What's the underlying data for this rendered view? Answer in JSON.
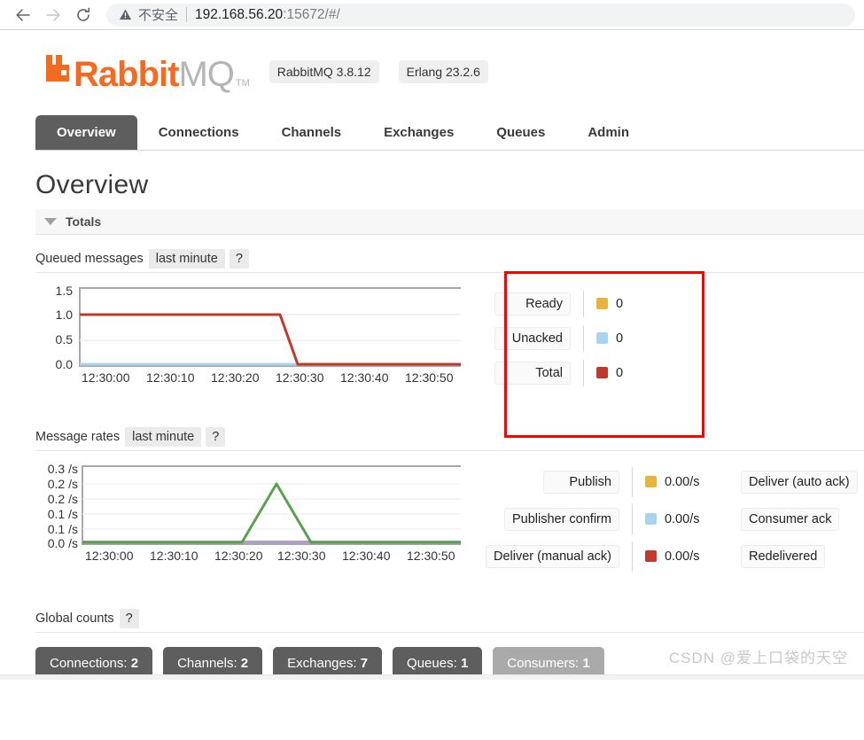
{
  "browser": {
    "back_icon": "arrow-left-icon",
    "forward_icon": "arrow-right-icon",
    "reload_icon": "reload-icon",
    "security_icon": "warning-triangle-icon",
    "security_label": "不安全",
    "url_host": "192.168.56.20",
    "url_rest": ":15672/#/"
  },
  "brand": {
    "logo_rabbit": "Rabbit",
    "logo_mq": "MQ",
    "trademark": "TM",
    "version_badge": "RabbitMQ 3.8.12",
    "erlang_badge": "Erlang 23.2.6"
  },
  "nav": {
    "tabs": [
      {
        "label": "Overview",
        "active": true
      },
      {
        "label": "Connections",
        "active": false
      },
      {
        "label": "Channels",
        "active": false
      },
      {
        "label": "Exchanges",
        "active": false
      },
      {
        "label": "Queues",
        "active": false
      },
      {
        "label": "Admin",
        "active": false
      }
    ]
  },
  "page": {
    "title": "Overview",
    "totals_label": "Totals"
  },
  "queued": {
    "title": "Queued messages",
    "period": "last minute",
    "help": "?",
    "legend": [
      {
        "label": "Ready",
        "color": "#e8b33a",
        "value": "0"
      },
      {
        "label": "Unacked",
        "color": "#a8d4f0",
        "value": "0"
      },
      {
        "label": "Total",
        "color": "#c0392b",
        "value": "0"
      }
    ]
  },
  "rates": {
    "title": "Message rates",
    "period": "last minute",
    "help": "?",
    "legend_left": [
      {
        "label": "Publish",
        "color": "#e8b33a",
        "value": "0.00/s"
      },
      {
        "label": "Publisher confirm",
        "color": "#a8d4f0",
        "value": "0.00/s"
      },
      {
        "label": "Deliver (manual ack)",
        "color": "#c0392b",
        "value": "0.00/s"
      }
    ],
    "legend_right": [
      {
        "label": "Deliver (auto ack)"
      },
      {
        "label": "Consumer ack"
      },
      {
        "label": "Redelivered"
      }
    ]
  },
  "global_counts": {
    "title": "Global counts",
    "help": "?",
    "items": [
      {
        "label": "Connections:",
        "value": "2",
        "muted": false
      },
      {
        "label": "Channels:",
        "value": "2",
        "muted": false
      },
      {
        "label": "Exchanges:",
        "value": "7",
        "muted": false
      },
      {
        "label": "Queues:",
        "value": "1",
        "muted": false
      },
      {
        "label": "Consumers:",
        "value": "1",
        "muted": true
      }
    ]
  },
  "watermark": "CSDN @爱上口袋的天空",
  "chart_data": [
    {
      "type": "line",
      "title": "Queued messages",
      "xlabel": "",
      "ylabel": "",
      "ylim": [
        0,
        1.5
      ],
      "yticks": [
        "0.0",
        "0.5",
        "1.0",
        "1.5"
      ],
      "xticks": [
        "12:30:00",
        "12:30:10",
        "12:30:20",
        "12:30:30",
        "12:30:40",
        "12:30:50"
      ],
      "grid": true,
      "legend_position": "right",
      "series": [
        {
          "name": "Total",
          "color": "#c0392b",
          "x": [
            "12:30:00",
            "12:30:10",
            "12:30:20",
            "12:30:30",
            "12:30:33",
            "12:30:40",
            "12:30:50",
            "12:30:59"
          ],
          "values": [
            1,
            1,
            1,
            1,
            0,
            0,
            0,
            0
          ]
        },
        {
          "name": "Unacked",
          "color": "#a8d4f0",
          "x": [
            "12:30:00",
            "12:30:10",
            "12:30:20",
            "12:30:30",
            "12:30:40",
            "12:30:50",
            "12:30:59"
          ],
          "values": [
            0,
            0,
            0,
            0,
            0,
            0,
            0
          ]
        },
        {
          "name": "Ready",
          "color": "#e8b33a",
          "x": [
            "12:30:00",
            "12:30:10",
            "12:30:20",
            "12:30:30",
            "12:30:40",
            "12:30:50",
            "12:30:59"
          ],
          "values": [
            0,
            0,
            0,
            0,
            0,
            0,
            0
          ]
        }
      ]
    },
    {
      "type": "line",
      "title": "Message rates",
      "xlabel": "",
      "ylabel": "/s",
      "ylim": [
        0,
        0.3
      ],
      "yticks": [
        "0.3 /s",
        "0.2 /s",
        "0.2 /s",
        "0.1 /s",
        "0.1 /s",
        "0.0 /s"
      ],
      "xticks": [
        "12:30:00",
        "12:30:10",
        "12:30:20",
        "12:30:30",
        "12:30:40",
        "12:30:50"
      ],
      "grid": true,
      "legend_position": "right",
      "series": [
        {
          "name": "Deliver (manual ack)",
          "color": "#5aa04f",
          "x": [
            "12:30:00",
            "12:30:20",
            "12:30:24",
            "12:30:28",
            "12:30:33",
            "12:30:40",
            "12:30:59"
          ],
          "values": [
            0,
            0,
            0,
            0.25,
            0,
            0,
            0
          ]
        },
        {
          "name": "Publish",
          "color": "#b09ec4",
          "x": [
            "12:30:00",
            "12:30:10",
            "12:30:20",
            "12:30:30",
            "12:30:40",
            "12:30:50",
            "12:30:59"
          ],
          "values": [
            0,
            0,
            0,
            0,
            0,
            0,
            0
          ]
        }
      ]
    }
  ]
}
